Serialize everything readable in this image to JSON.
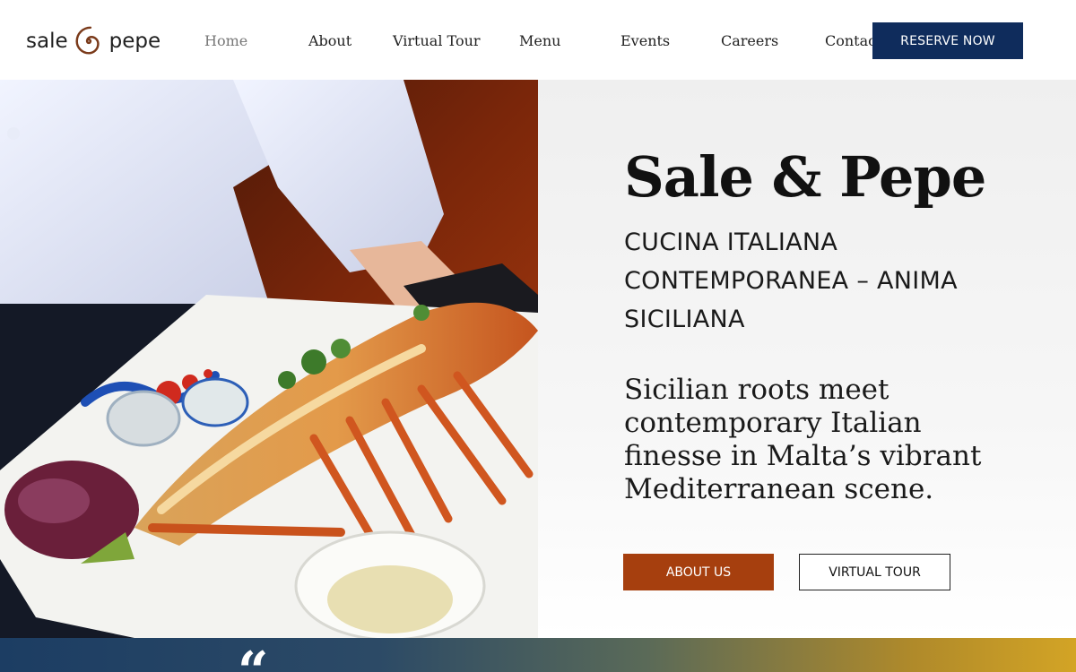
{
  "header": {
    "logo": {
      "word_left": "sale",
      "word_right": "pepe",
      "swirl_icon": "spiral-logo-icon",
      "swirl_color": "#7a3a1a"
    },
    "nav": [
      {
        "label": "Home",
        "active": true
      },
      {
        "label": "About",
        "active": false
      },
      {
        "label": "Virtual Tour",
        "active": false
      },
      {
        "label": "Menu",
        "active": false
      },
      {
        "label": "Events",
        "active": false
      },
      {
        "label": "Careers",
        "active": false
      },
      {
        "label": "Contact",
        "active": false
      }
    ],
    "reserve_label": "RESERVE NOW"
  },
  "hero": {
    "title": "Sale & Pepe",
    "subtitle": "CUCINA ITALIANA CONTEMPORANEA – ANIMA SICILIANA",
    "description": "Sicilian roots meet contemporary Italian finesse in Malta’s vibrant Mediterranean scene.",
    "about_label": "ABOUT US",
    "tour_label": "VIRTUAL TOUR",
    "image_subject": "chef-serving-grilled-lobster-photo"
  },
  "testimonial": {
    "quote_icon": "quote-mark-icon",
    "quote_glyph": "“"
  },
  "colors": {
    "reserve_button": "#0f2c5c",
    "about_button": "#a63f0e",
    "text_dark": "#111111",
    "nav_active": "#777777"
  }
}
